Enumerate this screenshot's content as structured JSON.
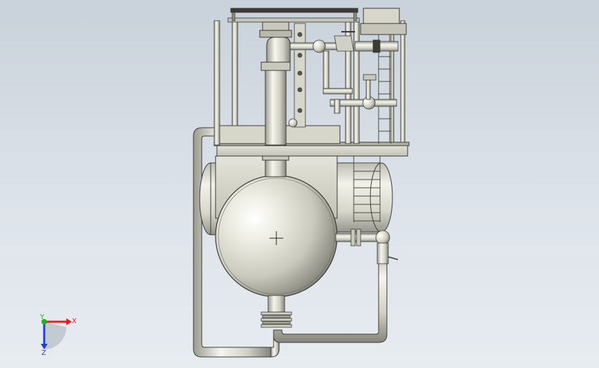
{
  "triad": {
    "x_label": "X",
    "y_label": "Y",
    "z_label": "Z",
    "x_color": "#e02020",
    "y_color": "#20b020",
    "z_color": "#2040d0"
  },
  "colors": {
    "background_top": "#c9d1da",
    "background_bottom": "#e7ecf1",
    "metal_light": "#f4f4ec",
    "metal_mid": "#d8d8cc",
    "metal_dark": "#8e8e84",
    "outline": "#3a3a36"
  }
}
